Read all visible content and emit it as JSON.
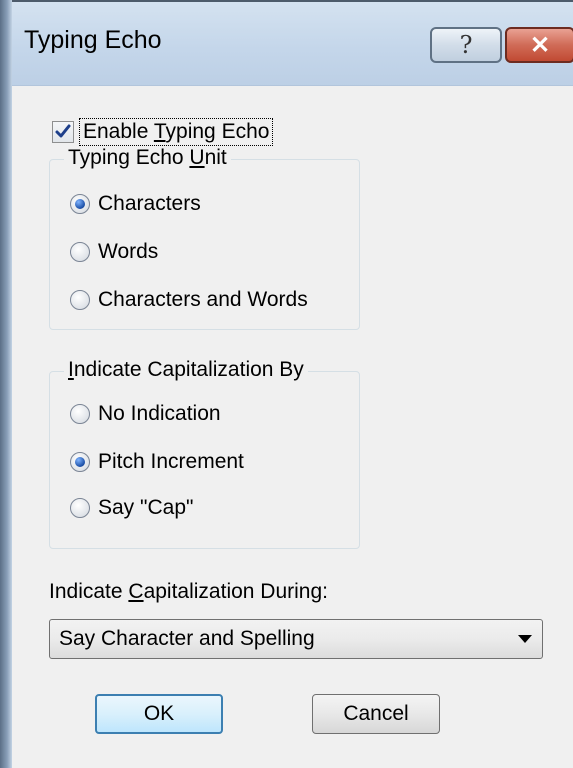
{
  "window": {
    "title": "Typing Echo",
    "help_label": "?",
    "close_label": "✕"
  },
  "enable_checkbox": {
    "label_pre": "Enable ",
    "label_mnemonic": "T",
    "label_post": "yping Echo",
    "checked": true
  },
  "unit_group": {
    "legend_pre": "Typing Echo ",
    "legend_mnemonic": "U",
    "legend_post": "nit",
    "options": [
      {
        "label": "Characters",
        "selected": true
      },
      {
        "label": "Words",
        "selected": false
      },
      {
        "label": "Characters and Words",
        "selected": false
      }
    ]
  },
  "cap_group": {
    "legend_mnemonic": "I",
    "legend_post": "ndicate Capitalization By",
    "options": [
      {
        "label": "No Indication",
        "selected": false
      },
      {
        "label": "Pitch Increment",
        "selected": true
      },
      {
        "label": "Say \"Cap\"",
        "selected": false
      }
    ]
  },
  "during": {
    "label_pre": "Indicate ",
    "label_mnemonic": "C",
    "label_post": "apitalization During:",
    "selected_value": "Say Character and Spelling"
  },
  "buttons": {
    "ok": "OK",
    "cancel": "Cancel"
  },
  "colors": {
    "title_bar": "#c4d6ea",
    "close_button": "#c14a33",
    "dialog_background": "#f0f0f0",
    "radio_selected": "#1a4ea6"
  }
}
